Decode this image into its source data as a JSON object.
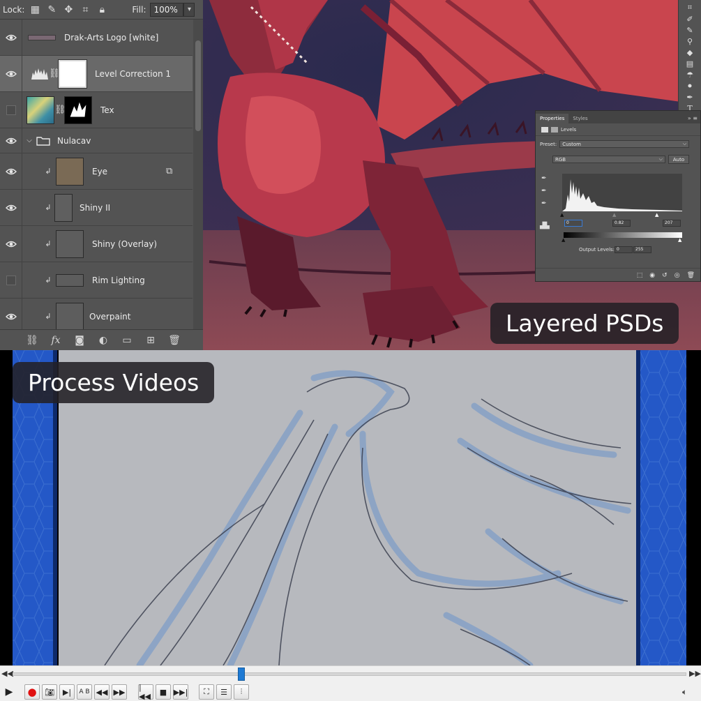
{
  "photoshop": {
    "lock_label": "Lock:",
    "fill_label": "Fill:",
    "fill_value": "100%",
    "layers": [
      {
        "name": "Drak-Arts Logo [white]",
        "visible": true,
        "indent": false
      },
      {
        "name": "Level Correction 1",
        "visible": true,
        "indent": false,
        "selected": true
      },
      {
        "name": "Tex",
        "visible": false,
        "indent": false
      },
      {
        "name": "Nulacav",
        "visible": true,
        "group": true
      },
      {
        "name": "Eye",
        "visible": true,
        "indent": true
      },
      {
        "name": "Shiny II",
        "visible": true,
        "indent": true
      },
      {
        "name": "Shiny (Overlay)",
        "visible": true,
        "indent": true
      },
      {
        "name": "Rim Lighting",
        "visible": false,
        "indent": true
      },
      {
        "name": "Overpaint",
        "visible": true,
        "indent": true
      }
    ],
    "properties": {
      "tab_active": "Properties",
      "tab_other": "Styles",
      "adjustment": "Levels",
      "preset_label": "Preset:",
      "preset_value": "Custom",
      "channel": "RGB",
      "auto_label": "Auto",
      "input_black": "0",
      "input_gamma": "0.82",
      "input_white": "207",
      "output_label": "Output Levels:",
      "output_black": "0",
      "output_white": "255"
    }
  },
  "captions": {
    "layered": "Layered PSDs",
    "process": "Process Videos"
  },
  "vlc": {
    "seek_position": 0.34
  }
}
